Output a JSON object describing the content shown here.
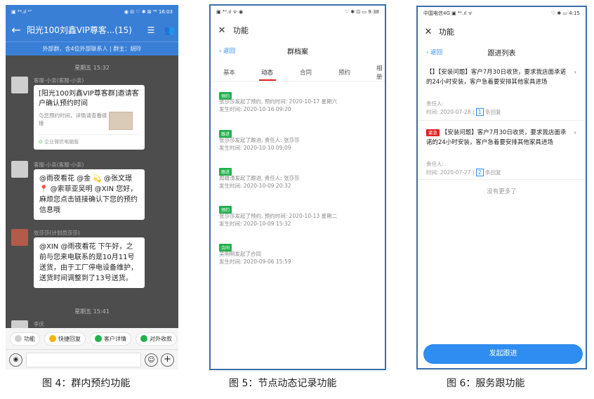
{
  "figure4": {
    "status": {
      "left": "▣ ⁴ᴳ.ıl ²⁷",
      "right": "◉ ⊟ ♡ ✱ ⊠ ⁶⁸ 16:03"
    },
    "title": "阳光100刘鑫VIP尊客...(15)",
    "subtitle": "外部群，含4位外部联系人 | 群主：胡玲",
    "time1": "星期五 15:32",
    "msg1": {
      "sender": "客服-小亲(客服-小亲)",
      "card_title": "[阳光100刘鑫VIP尊客群]邀请客户确认预约时间",
      "card_desc": "与您预约时间，详情请查看链接",
      "card_footer": "企业微信电脑版"
    },
    "msg2": {
      "sender": "客服-小亲(客服-小亲)",
      "text": "@雨夜看花 @金 💫 @张文璟 📍 @索菲亚吴明 @XIN 您好，麻烦您点击链接确认下您的预约信息哦"
    },
    "msg3": {
      "sender": "张莎莎(计划员莎莎)",
      "text": "@XIN @雨夜看花 下午好，之前与您来电联系的是10月11号送货，由于工厂停电设备维护，送货时间调整到了13号送货。"
    },
    "time2": "星期五 15:41",
    "msg4_sender": "李庆",
    "tools": [
      "功能",
      "快捷回复",
      "客户详情",
      "对外收款"
    ],
    "tool_colors": [
      "#cfcfcf",
      "#f4b400",
      "#21b24d",
      "#21b24d"
    ],
    "caption": "图 4：群内预约功能"
  },
  "figure5": {
    "status": {
      "left": "▣ ⁴ᴳ.ıl ᯤ ◉",
      "right": "♡ ✱ ⊡ ▭ 9:38"
    },
    "header_title": "功能",
    "back_label": "返回",
    "page_title": "群档案",
    "tabs": [
      "基本",
      "动态",
      "合同",
      "预约",
      "相册"
    ],
    "active_tab": "动态",
    "records": [
      {
        "tag": "预约",
        "line1": "张莎莎发起了预约, 预约时间: 2020-10-17 星期六",
        "line2": "发生时间: 2020-10-16 09:20"
      },
      {
        "tag": "跟进",
        "line1": "张莎莎发起了跟进, 责任人: 张莎莎",
        "line2": "发生时间: 2020-10-10 09:09"
      },
      {
        "tag": "跟进",
        "line1": "周雄涛发起了跟进, 责任人: 张莎莎",
        "line2": "发生时间: 2020-10-09 20:32"
      },
      {
        "tag": "预约",
        "line1": "张莎莎发起了预约, 预约时间: 2020-10-13 星期二",
        "line2": "发生时间: 2020-10-09 15:32"
      },
      {
        "tag": "合同",
        "line1": "吴明明发起了合同",
        "line2": "发生时间: 2020-09-06 15:59"
      }
    ],
    "caption": "图 5：节点动态记录功能"
  },
  "figure6": {
    "status": {
      "left": "中国电信4G ▣ ⁴ᴳ.ıl ᯤ",
      "right": "♡ ✱ ▭ 4:15"
    },
    "header_title": "功能",
    "back_label": "返回",
    "page_title": "跟进列表",
    "items": [
      {
        "badge": "",
        "text": "【】【安装问题】客户7月30日收货，要求我店面承诺的24小时安装，客户急着要安排其他家具进场",
        "owner": "责任人:",
        "time": "时间: 2020-07-28 |",
        "reply_count": "1",
        "reply_label": "条回复"
      },
      {
        "badge": "紧急",
        "text": "【安装问题】客户7月30日收货，要求我店面承诺的24小时安装，客户急着要安排其他家具进场",
        "owner": "责任人:",
        "time": "时间: 2020-07-27 |",
        "reply_count": "2",
        "reply_label": "条回复"
      }
    ],
    "no_more": "没有更多了",
    "button": "发起跟进",
    "caption": "图 6：服务跟功能"
  }
}
